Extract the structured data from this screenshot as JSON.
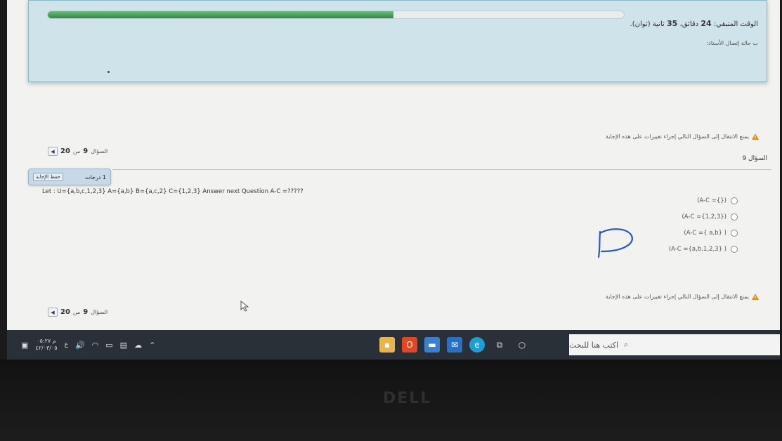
{
  "timer": {
    "label": "الوقت المتبقي:",
    "minutes": "24",
    "minutes_unit": "دقائق،",
    "seconds": "35",
    "seconds_unit": "ثانية (ثوان).",
    "progress_percent": 60,
    "connection_status": "ب حالة إتصال الأستاذ:"
  },
  "navigation": {
    "warning": "يمنع الانتقال إلى السؤال التالي إجراء تغييرات على هذه الإجابة",
    "counter_prefix": "السؤال",
    "counter_current": "9",
    "counter_sep": "من",
    "counter_total": "20"
  },
  "question": {
    "title": "السؤال 9",
    "grade": "1 درجات",
    "save_label": "حفظ الإجابة",
    "text": "Let : U={a,b,c,1,2,3} A={a,b} B={a,c,2} C={1,2,3} Answer next Question A-C =?????",
    "options": [
      "(A-C ={})",
      "(A-C ={1,2,3})",
      "(A-C ={ a,b} )",
      "(A-C ={a,b,1,2,3} )"
    ]
  },
  "taskbar": {
    "search_placeholder": "اكتب هنا للبحث",
    "time": "م ٠٥:٢٧",
    "date": "٤٢/٠٣/٠٥",
    "lang": "ع"
  },
  "colors": {
    "accent": "#2f8a45",
    "panel": "#cfe3ea"
  }
}
